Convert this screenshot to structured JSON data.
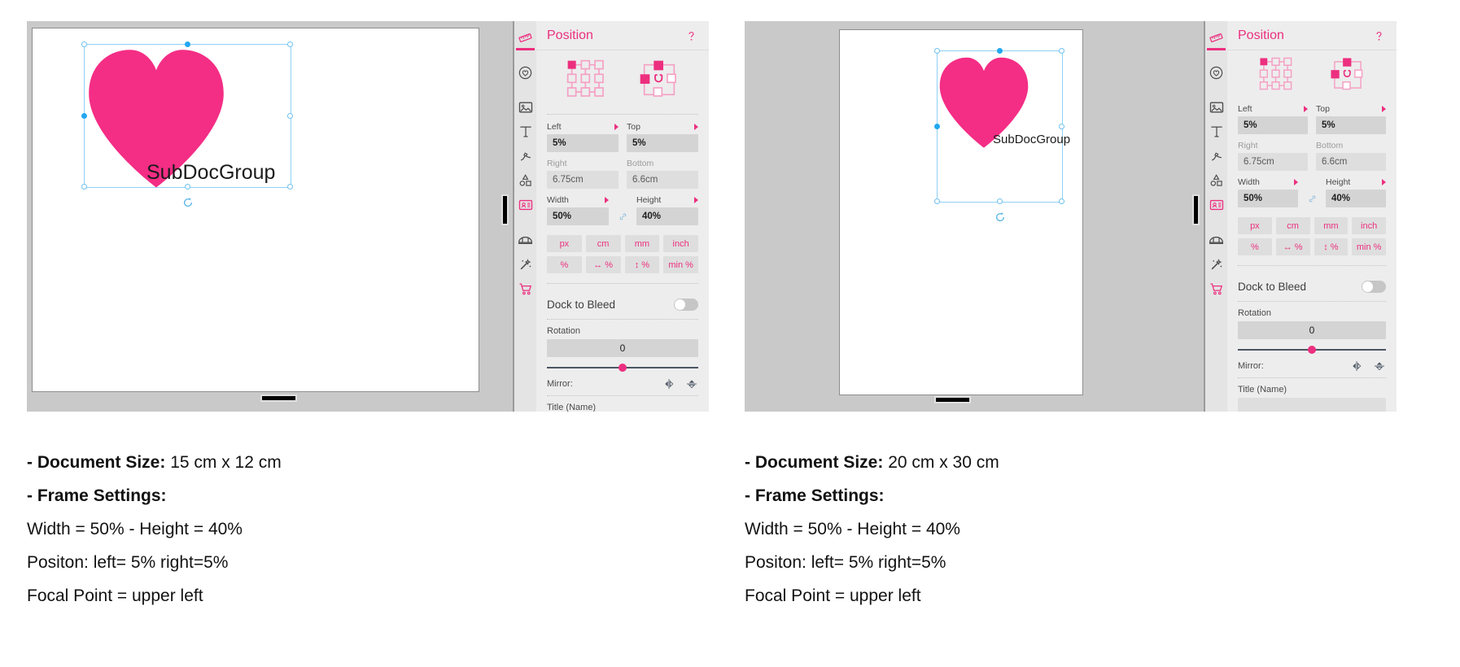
{
  "panels": [
    {
      "id": "left",
      "document": {
        "frame_label": "SubDocGroup",
        "shape": "heart"
      },
      "properties": {
        "title": "Position",
        "help_icon": "help-icon",
        "anchor_grid_icon": "anchor-grid-icon",
        "anchor_magnet_icon": "anchor-magnet-icon",
        "fields": {
          "left_label": "Left",
          "left_value": "5%",
          "top_label": "Top",
          "top_value": "5%",
          "right_label": "Right",
          "right_value": "6.75cm",
          "bottom_label": "Bottom",
          "bottom_value": "6.6cm",
          "width_label": "Width",
          "width_value": "50%",
          "height_label": "Height",
          "height_value": "40%"
        },
        "units": [
          "px",
          "cm",
          "mm",
          "inch"
        ],
        "percent_units": [
          "%",
          "%",
          "%",
          "min %"
        ],
        "dock_to_bleed_label": "Dock to Bleed",
        "dock_to_bleed_on": false,
        "rotation_label": "Rotation",
        "rotation_value": "0",
        "mirror_label": "Mirror:",
        "title_name_label": "Title (Name)",
        "title_name_value": ""
      },
      "tools": [
        {
          "name": "ruler-icon",
          "active": true
        },
        {
          "name": "heart-circle-icon",
          "active": false
        },
        {
          "name": "image-icon",
          "active": false
        },
        {
          "name": "text-icon",
          "active": false
        },
        {
          "name": "pen-path-icon",
          "active": false
        },
        {
          "name": "shapes-icon",
          "active": false
        },
        {
          "name": "id-card-icon",
          "active": true
        },
        {
          "name": "crown-icon",
          "active": false
        },
        {
          "name": "magic-wand-icon",
          "active": false
        },
        {
          "name": "cart-icon",
          "active": false
        }
      ],
      "caption": {
        "line1_bold": "- Document Size:",
        "line1_rest": " 15 cm x 12 cm",
        "line2_bold": "- Frame Settings:",
        "line3": "Width = 50% - Height = 40%",
        "line4": "Positon: left= 5% right=5%",
        "line5": "Focal Point = upper left"
      }
    },
    {
      "id": "right",
      "document": {
        "frame_label": "SubDocGroup",
        "shape": "heart"
      },
      "properties": {
        "title": "Position",
        "help_icon": "help-icon",
        "anchor_grid_icon": "anchor-grid-icon",
        "anchor_magnet_icon": "anchor-magnet-icon",
        "fields": {
          "left_label": "Left",
          "left_value": "5%",
          "top_label": "Top",
          "top_value": "5%",
          "right_label": "Right",
          "right_value": "6.75cm",
          "bottom_label": "Bottom",
          "bottom_value": "6.6cm",
          "width_label": "Width",
          "width_value": "50%",
          "height_label": "Height",
          "height_value": "40%"
        },
        "units": [
          "px",
          "cm",
          "mm",
          "inch"
        ],
        "percent_units": [
          "%",
          "%",
          "%",
          "min %"
        ],
        "dock_to_bleed_label": "Dock to Bleed",
        "dock_to_bleed_on": false,
        "rotation_label": "Rotation",
        "rotation_value": "0",
        "mirror_label": "Mirror:",
        "title_name_label": "Title (Name)",
        "title_name_value": ""
      },
      "tools": [
        {
          "name": "ruler-icon",
          "active": true
        },
        {
          "name": "heart-circle-icon",
          "active": false
        },
        {
          "name": "image-icon",
          "active": false
        },
        {
          "name": "text-icon",
          "active": false
        },
        {
          "name": "pen-path-icon",
          "active": false
        },
        {
          "name": "shapes-icon",
          "active": false
        },
        {
          "name": "id-card-icon",
          "active": true
        },
        {
          "name": "crown-icon",
          "active": false
        },
        {
          "name": "magic-wand-icon",
          "active": false
        },
        {
          "name": "cart-icon",
          "active": false
        }
      ],
      "caption": {
        "line1_bold": "- Document Size:",
        "line1_rest": " 20 cm x 30 cm",
        "line2_bold": "- Frame Settings:",
        "line3": "Width = 50% - Height = 40%",
        "line4": "Positon: left= 5% right=5%",
        "line5": "Focal Point = upper left"
      }
    }
  ],
  "colors": {
    "accent_pink": "#ec2f7f",
    "heart_fill": "#f42d85",
    "selection_blue": "#8fd0f5",
    "handle_active": "#22a7f0",
    "panel_bg": "#ededed",
    "canvas_bg": "#c9c9c9"
  }
}
